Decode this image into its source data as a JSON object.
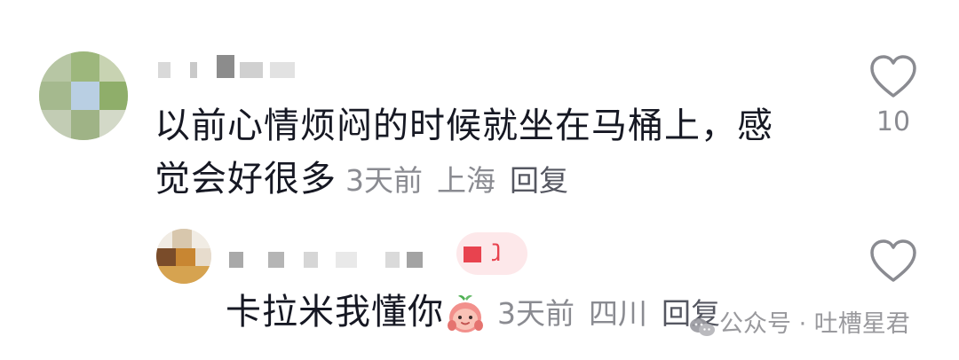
{
  "comment": {
    "text": "以前心情烦闷的时候就坐在马桶上，感觉会好很多",
    "time": "3天前",
    "location": "上海",
    "reply_label": "回复",
    "like_count": "10",
    "like_icon": "heart-outline-icon"
  },
  "reply": {
    "author_badge": "ⱹ",
    "text": "卡拉米我懂你",
    "emoji": "peach-emoji-icon",
    "time": "3天前",
    "location": "四川",
    "reply_label": "回复",
    "like_icon": "heart-outline-icon"
  },
  "watermark": {
    "text": "公众号 · 吐槽星君"
  },
  "colors": {
    "text_primary": "#161823",
    "text_secondary": "#8a8b91",
    "author_tag_bg": "#fde8ea",
    "author_tag_fg": "#e8434f"
  }
}
